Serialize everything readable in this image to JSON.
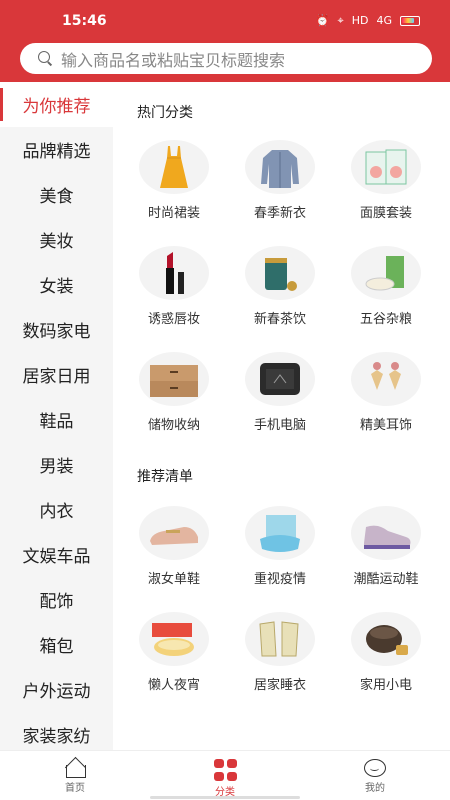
{
  "status_bar": {
    "time": "15:46",
    "network": "HD",
    "signal": "4G"
  },
  "search": {
    "placeholder": "输入商品名或粘贴宝贝标题搜索"
  },
  "sidebar": {
    "items": [
      {
        "label": "为你推荐",
        "active": true
      },
      {
        "label": "品牌精选"
      },
      {
        "label": "美食"
      },
      {
        "label": "美妆"
      },
      {
        "label": "女装"
      },
      {
        "label": "数码家电"
      },
      {
        "label": "居家日用"
      },
      {
        "label": "鞋品"
      },
      {
        "label": "男装"
      },
      {
        "label": "内衣"
      },
      {
        "label": "文娱车品"
      },
      {
        "label": "配饰"
      },
      {
        "label": "箱包"
      },
      {
        "label": "户外运动"
      },
      {
        "label": "家装家纺"
      }
    ]
  },
  "hot_section": {
    "title": "热门分类",
    "items": [
      {
        "label": "时尚裙装",
        "icon": "dress-icon"
      },
      {
        "label": "春季新衣",
        "icon": "jacket-icon"
      },
      {
        "label": "面膜套装",
        "icon": "face-mask-icon"
      },
      {
        "label": "诱惑唇妆",
        "icon": "lipstick-icon"
      },
      {
        "label": "新春茶饮",
        "icon": "tea-icon"
      },
      {
        "label": "五谷杂粮",
        "icon": "grain-icon"
      },
      {
        "label": "储物收纳",
        "icon": "storage-box-icon"
      },
      {
        "label": "手机电脑",
        "icon": "phone-icon"
      },
      {
        "label": "精美耳饰",
        "icon": "earring-icon"
      }
    ]
  },
  "recommend_section": {
    "title": "推荐清单",
    "items": [
      {
        "label": "淑女单鞋",
        "icon": "flat-shoe-icon"
      },
      {
        "label": "重视疫情",
        "icon": "medical-mask-icon"
      },
      {
        "label": "潮酷运动鞋",
        "icon": "sneaker-icon"
      },
      {
        "label": "懒人夜宵",
        "icon": "noodle-icon"
      },
      {
        "label": "居家睡衣",
        "icon": "pajamas-icon"
      },
      {
        "label": "家用小电",
        "icon": "rice-cooker-icon"
      }
    ]
  },
  "bottom_nav": {
    "items": [
      {
        "label": "首页",
        "icon": "home-icon"
      },
      {
        "label": "分类",
        "icon": "category-icon",
        "active": true
      },
      {
        "label": "我的",
        "icon": "profile-icon"
      }
    ]
  },
  "colors": {
    "brand": "#d9373a",
    "sidebar_bg": "#f5f5f5"
  }
}
